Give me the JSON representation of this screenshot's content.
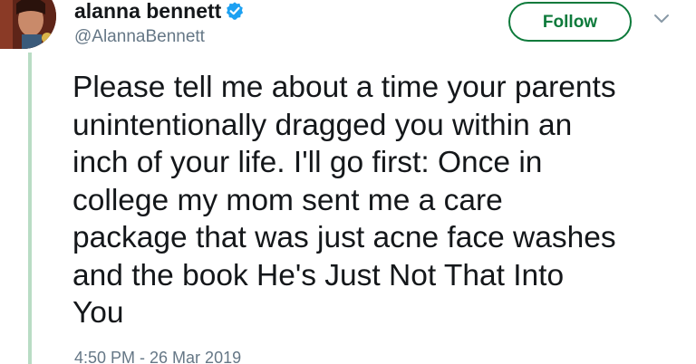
{
  "author": {
    "display_name": "alanna bennett",
    "handle": "@AlannaBennett",
    "verified": true,
    "verified_icon": "verified-badge-icon"
  },
  "actions": {
    "follow_label": "Follow",
    "menu_icon": "chevron-down-icon"
  },
  "tweet": {
    "text": "Please tell me about a time your parents\nunintentionally dragged you within an\ninch of your life. I'll go first: Once in\ncollege my mom sent me a care\npackage that was just acne face washes\nand the book He's Just Not That Into\nYou",
    "timestamp": "4:50 PM - 26 Mar 2019"
  },
  "colors": {
    "accent": "#0d7a3b",
    "verified_blue": "#1da1f2",
    "thread_line": "#b9dcc4",
    "text_primary": "#14171a",
    "text_secondary": "#657786"
  }
}
